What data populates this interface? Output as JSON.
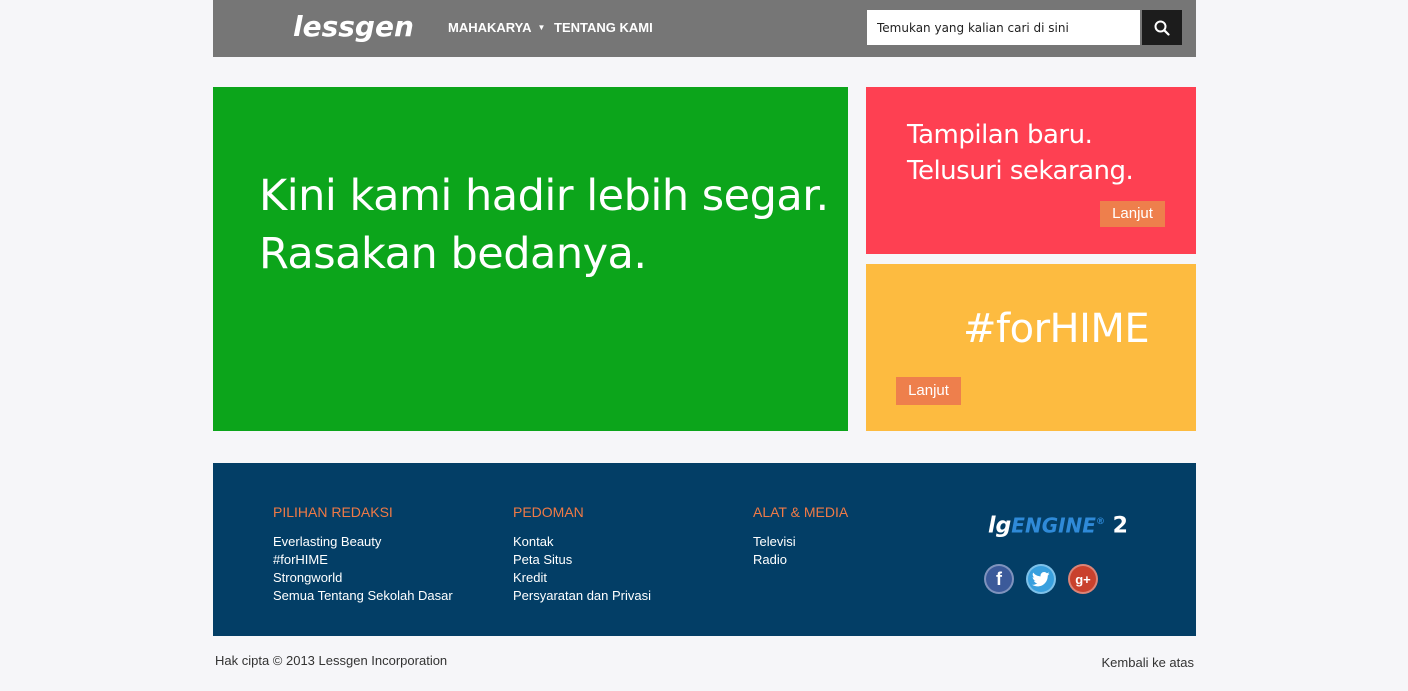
{
  "header": {
    "logo": "lessgen",
    "nav": [
      {
        "label": "MAHAKARYA"
      },
      {
        "label": "TENTANG KAMI"
      }
    ],
    "search_placeholder": "Temukan yang kalian cari di sini",
    "search_icon": "search-icon"
  },
  "tiles": {
    "main": {
      "line1": "Kini kami hadir lebih segar.",
      "line2": "Rasakan bedanya.",
      "color": "#0ca51b"
    },
    "promo1": {
      "line1": "Tampilan baru.",
      "line2": "Telusuri sekarang.",
      "button": "Lanjut",
      "color": "#fe4052"
    },
    "promo2": {
      "title": "#forHIME",
      "button": "Lanjut",
      "color": "#fdbb40"
    }
  },
  "footer": {
    "columns": [
      {
        "heading": "PILIHAN REDAKSI",
        "items": [
          "Everlasting Beauty",
          "#forHIME",
          "Strongworld",
          "Semua Tentang Sekolah Dasar"
        ]
      },
      {
        "heading": "PEDOMAN",
        "items": [
          "Kontak",
          "Peta Situs",
          "Kredit",
          "Persyaratan dan Privasi"
        ]
      },
      {
        "heading": "ALAT & MEDIA",
        "items": [
          "Televisi",
          "Radio"
        ]
      }
    ],
    "engine_logo": {
      "prefix": "lg",
      "name": "ENGINE",
      "mark": "®",
      "version": "2"
    },
    "social": [
      {
        "icon": "facebook-icon",
        "glyph": "f"
      },
      {
        "icon": "twitter-icon",
        "glyph": ""
      },
      {
        "icon": "google-plus-icon",
        "glyph": "g+"
      }
    ],
    "background": "#033e66",
    "heading_color": "#f07a46"
  },
  "bottom": {
    "copyright": "Hak cipta © 2013 Lessgen Incorporation",
    "back_to_top": "Kembali ke atas"
  }
}
